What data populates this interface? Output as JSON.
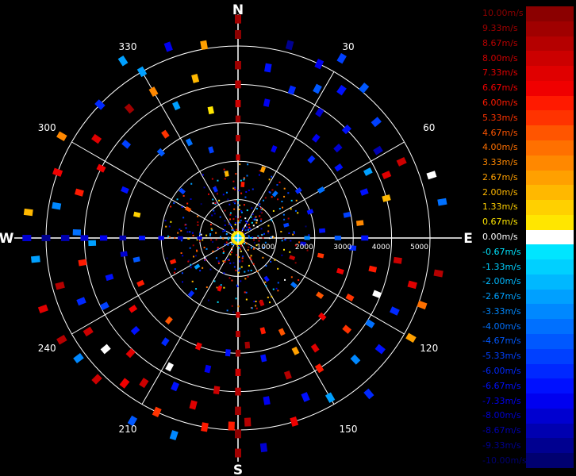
{
  "chart_data": {
    "type": "polar-scatter",
    "title": "",
    "compass": [
      "N",
      "E",
      "S",
      "W"
    ],
    "angle_labels": [
      "30",
      "60",
      "120",
      "150",
      "210",
      "240",
      "300",
      "330"
    ],
    "range_ticks": [
      "1000",
      "2000",
      "3000",
      "4000",
      "5000"
    ],
    "rmax": 5000,
    "grid": true,
    "colorbar": {
      "position": "right",
      "labels": [
        "10.00m/s",
        "9.33m/s",
        "8.67m/s",
        "8.00m/s",
        "7.33m/s",
        "6.67m/s",
        "6.00m/s",
        "5.33m/s",
        "4.67m/s",
        "4.00m/s",
        "3.33m/s",
        "2.67m/s",
        "2.00m/s",
        "1.33m/s",
        "0.67m/s",
        "0.00m/s",
        "-0.67m/s",
        "-1.33m/s",
        "-2.00m/s",
        "-2.67m/s",
        "-3.33m/s",
        "-4.00m/s",
        "-4.67m/s",
        "-5.33m/s",
        "-6.00m/s",
        "-6.67m/s",
        "-7.33m/s",
        "-8.00m/s",
        "-8.67m/s",
        "-9.33m/s",
        "-10.00m/s"
      ],
      "colors": [
        "#8b0000",
        "#a00000",
        "#b50000",
        "#cc0000",
        "#e00000",
        "#f00000",
        "#ff1a00",
        "#ff3300",
        "#ff5500",
        "#ff7000",
        "#ff8800",
        "#ffa000",
        "#ffb800",
        "#ffd000",
        "#ffe600",
        "#ffffff",
        "#00e5ff",
        "#00d0ff",
        "#00b8ff",
        "#00a0ff",
        "#0088ff",
        "#0070ff",
        "#0058ff",
        "#0040ff",
        "#0028ff",
        "#0010ff",
        "#0000f0",
        "#0000d0",
        "#0000b0",
        "#000090",
        "#000070"
      ]
    },
    "points": [
      {
        "az": 0,
        "r": 2100,
        "v": 8.0
      },
      {
        "az": 0,
        "r": 2600,
        "v": 8.67
      },
      {
        "az": 0,
        "r": 3100,
        "v": 9.33
      },
      {
        "az": 0,
        "r": 3500,
        "v": 8.0
      },
      {
        "az": 0,
        "r": 4000,
        "v": 8.67
      },
      {
        "az": 0,
        "r": 4500,
        "v": 9.33
      },
      {
        "az": 0,
        "r": 5300,
        "v": 10.0
      },
      {
        "az": 0,
        "r": 5700,
        "v": 9.33
      },
      {
        "az": 180,
        "r": 2000,
        "v": 8.0
      },
      {
        "az": 180,
        "r": 2500,
        "v": 8.67
      },
      {
        "az": 180,
        "r": 3000,
        "v": 9.33
      },
      {
        "az": 180,
        "r": 3500,
        "v": 8.0
      },
      {
        "az": 180,
        "r": 4000,
        "v": 8.67
      },
      {
        "az": 180,
        "r": 4500,
        "v": 9.33
      },
      {
        "az": 180,
        "r": 5100,
        "v": 10.0
      },
      {
        "az": 180,
        "r": 5600,
        "v": 9.33
      },
      {
        "az": 182,
        "r": 4900,
        "v": 6.0
      },
      {
        "az": 270,
        "r": 1000,
        "v": -8.0
      },
      {
        "az": 270,
        "r": 1500,
        "v": -8.67
      },
      {
        "az": 270,
        "r": 2000,
        "v": -7.33
      },
      {
        "az": 270,
        "r": 2500,
        "v": -6.67
      },
      {
        "az": 270,
        "r": 3000,
        "v": -8.67
      },
      {
        "az": 270,
        "r": 3500,
        "v": -7.33
      },
      {
        "az": 270,
        "r": 4000,
        "v": -8.0
      },
      {
        "az": 270,
        "r": 4500,
        "v": -8.67
      },
      {
        "az": 270,
        "r": 5000,
        "v": -9.33
      },
      {
        "az": 270,
        "r": 5500,
        "v": -8.0
      },
      {
        "az": 272,
        "r": 4200,
        "v": -4.0
      },
      {
        "az": 268,
        "r": 3800,
        "v": -2.67
      },
      {
        "az": 90,
        "r": 1800,
        "v": -3.33
      },
      {
        "az": 90,
        "r": 2600,
        "v": -4.67
      },
      {
        "az": 90,
        "r": 3300,
        "v": -6.67
      },
      {
        "az": 330,
        "r": 5000,
        "v": -2.67
      },
      {
        "az": 330,
        "r": 4400,
        "v": 3.33
      },
      {
        "az": 335,
        "r": 3800,
        "v": -2.67
      },
      {
        "az": 333,
        "r": 2800,
        "v": -4.0
      },
      {
        "az": 325,
        "r": 3300,
        "v": 5.33
      },
      {
        "az": 340,
        "r": 5300,
        "v": -7.33
      },
      {
        "az": 345,
        "r": 4300,
        "v": 2.0
      },
      {
        "az": 350,
        "r": 5100,
        "v": 2.67
      },
      {
        "az": 348,
        "r": 3400,
        "v": 0.67
      },
      {
        "az": 343,
        "r": 2400,
        "v": -5.33
      },
      {
        "az": 320,
        "r": 4400,
        "v": 9.33
      },
      {
        "az": 318,
        "r": 3000,
        "v": -4.67
      },
      {
        "az": 310,
        "r": 3800,
        "v": -5.33
      },
      {
        "az": 305,
        "r": 4500,
        "v": 7.33
      },
      {
        "az": 300,
        "r": 5300,
        "v": 3.33
      },
      {
        "az": 297,
        "r": 4000,
        "v": 6.67
      },
      {
        "az": 293,
        "r": 3200,
        "v": -6.67
      },
      {
        "az": 286,
        "r": 4300,
        "v": 6.0
      },
      {
        "az": 283,
        "r": 2700,
        "v": 1.33
      },
      {
        "az": 280,
        "r": 4800,
        "v": -3.33
      },
      {
        "az": 277,
        "r": 5500,
        "v": 2.0
      },
      {
        "az": 290,
        "r": 5000,
        "v": 6.67
      },
      {
        "az": 314,
        "r": 5000,
        "v": -6.0
      },
      {
        "az": 327,
        "r": 5500,
        "v": -2.67
      },
      {
        "az": 10,
        "r": 4500,
        "v": -6.67
      },
      {
        "az": 12,
        "r": 3600,
        "v": -7.33
      },
      {
        "az": 15,
        "r": 5200,
        "v": -9.33
      },
      {
        "az": 20,
        "r": 4100,
        "v": -6.0
      },
      {
        "az": 25,
        "r": 5000,
        "v": -7.33
      },
      {
        "az": 28,
        "r": 4400,
        "v": -4.67
      },
      {
        "az": 30,
        "r": 5400,
        "v": -5.33
      },
      {
        "az": 33,
        "r": 3900,
        "v": -8.0
      },
      {
        "az": 35,
        "r": 4700,
        "v": -6.67
      },
      {
        "az": 38,
        "r": 3300,
        "v": -7.33
      },
      {
        "az": 40,
        "r": 5100,
        "v": -4.67
      },
      {
        "az": 43,
        "r": 2800,
        "v": -6.0
      },
      {
        "az": 45,
        "r": 4000,
        "v": -6.67
      },
      {
        "az": 48,
        "r": 3500,
        "v": -8.0
      },
      {
        "az": 50,
        "r": 4700,
        "v": -5.33
      },
      {
        "az": 55,
        "r": 3200,
        "v": -6.67
      },
      {
        "az": 58,
        "r": 4300,
        "v": -8.67
      },
      {
        "az": 60,
        "r": 2500,
        "v": -4.0
      },
      {
        "az": 63,
        "r": 3800,
        "v": -2.67
      },
      {
        "az": 65,
        "r": 4700,
        "v": 8.0
      },
      {
        "az": 67,
        "r": 4200,
        "v": 7.33
      },
      {
        "az": 70,
        "r": 3500,
        "v": -6.67
      },
      {
        "az": 72,
        "r": 5300,
        "v": 0.0
      },
      {
        "az": 75,
        "r": 4000,
        "v": 2.0
      },
      {
        "az": 78,
        "r": 2900,
        "v": -5.33
      },
      {
        "az": 80,
        "r": 5400,
        "v": -4.0
      },
      {
        "az": 83,
        "r": 3200,
        "v": 3.33
      },
      {
        "az": 85,
        "r": 2200,
        "v": -6.67
      },
      {
        "az": 22,
        "r": 2500,
        "v": -7.33
      },
      {
        "az": 52,
        "r": 2000,
        "v": -6.0
      },
      {
        "az": 95,
        "r": 3000,
        "v": -6.0
      },
      {
        "az": 98,
        "r": 4200,
        "v": 8.0
      },
      {
        "az": 100,
        "r": 5300,
        "v": 8.67
      },
      {
        "az": 103,
        "r": 3600,
        "v": 6.0
      },
      {
        "az": 105,
        "r": 4700,
        "v": 7.33
      },
      {
        "az": 108,
        "r": 2800,
        "v": 6.67
      },
      {
        "az": 110,
        "r": 5100,
        "v": 4.0
      },
      {
        "az": 112,
        "r": 3900,
        "v": 0.0
      },
      {
        "az": 115,
        "r": 4500,
        "v": -6.0
      },
      {
        "az": 118,
        "r": 3300,
        "v": 5.33
      },
      {
        "az": 120,
        "r": 5200,
        "v": 2.67
      },
      {
        "az": 123,
        "r": 4100,
        "v": -4.0
      },
      {
        "az": 125,
        "r": 2600,
        "v": 4.67
      },
      {
        "az": 128,
        "r": 4700,
        "v": -6.67
      },
      {
        "az": 130,
        "r": 3700,
        "v": 5.33
      },
      {
        "az": 133,
        "r": 3000,
        "v": 6.67
      },
      {
        "az": 136,
        "r": 4400,
        "v": -3.33
      },
      {
        "az": 140,
        "r": 5300,
        "v": -6.0
      },
      {
        "az": 145,
        "r": 3500,
        "v": 7.33
      },
      {
        "az": 148,
        "r": 4000,
        "v": 6.0
      },
      {
        "az": 150,
        "r": 4800,
        "v": -2.67
      },
      {
        "az": 153,
        "r": 3300,
        "v": 2.67
      },
      {
        "az": 155,
        "r": 2700,
        "v": 4.67
      },
      {
        "az": 157,
        "r": 4500,
        "v": -6.67
      },
      {
        "az": 160,
        "r": 3800,
        "v": 8.67
      },
      {
        "az": 163,
        "r": 5000,
        "v": 6.67
      },
      {
        "az": 165,
        "r": 2500,
        "v": 6.0
      },
      {
        "az": 168,
        "r": 3200,
        "v": -6.67
      },
      {
        "az": 170,
        "r": 4300,
        "v": -7.33
      },
      {
        "az": 173,
        "r": 5500,
        "v": -8.0
      },
      {
        "az": 175,
        "r": 2800,
        "v": 9.33
      },
      {
        "az": 177,
        "r": 4800,
        "v": 8.67
      },
      {
        "az": 102,
        "r": 2200,
        "v": 5.33
      },
      {
        "az": 185,
        "r": 3000,
        "v": -6.67
      },
      {
        "az": 188,
        "r": 4000,
        "v": 8.0
      },
      {
        "az": 190,
        "r": 5000,
        "v": 6.0
      },
      {
        "az": 193,
        "r": 3500,
        "v": -7.33
      },
      {
        "az": 195,
        "r": 4500,
        "v": 7.33
      },
      {
        "az": 198,
        "r": 5400,
        "v": -3.33
      },
      {
        "az": 200,
        "r": 3000,
        "v": 6.67
      },
      {
        "az": 203,
        "r": 4200,
        "v": -6.67
      },
      {
        "az": 205,
        "r": 5000,
        "v": 5.33
      },
      {
        "az": 208,
        "r": 3800,
        "v": 0.0
      },
      {
        "az": 210,
        "r": 5500,
        "v": -4.67
      },
      {
        "az": 213,
        "r": 4500,
        "v": 8.0
      },
      {
        "az": 215,
        "r": 3300,
        "v": -6.0
      },
      {
        "az": 218,
        "r": 4800,
        "v": 6.67
      },
      {
        "az": 220,
        "r": 2800,
        "v": 4.67
      },
      {
        "az": 223,
        "r": 4100,
        "v": 7.33
      },
      {
        "az": 225,
        "r": 5200,
        "v": 8.0
      },
      {
        "az": 228,
        "r": 3600,
        "v": -6.67
      },
      {
        "az": 230,
        "r": 4500,
        "v": 0.0
      },
      {
        "az": 233,
        "r": 5200,
        "v": -3.33
      },
      {
        "az": 236,
        "r": 3300,
        "v": 6.67
      },
      {
        "az": 238,
        "r": 4600,
        "v": 8.0
      },
      {
        "az": 240,
        "r": 5300,
        "v": 8.67
      },
      {
        "az": 243,
        "r": 3900,
        "v": -5.33
      },
      {
        "az": 245,
        "r": 2800,
        "v": 6.0
      },
      {
        "az": 248,
        "r": 4400,
        "v": -6.0
      },
      {
        "az": 250,
        "r": 5400,
        "v": 7.33
      },
      {
        "az": 253,
        "r": 3500,
        "v": -6.67
      },
      {
        "az": 255,
        "r": 4800,
        "v": 8.67
      },
      {
        "az": 258,
        "r": 2700,
        "v": -4.67
      },
      {
        "az": 261,
        "r": 4100,
        "v": 6.0
      },
      {
        "az": 264,
        "r": 5300,
        "v": -2.67
      },
      {
        "az": 262,
        "r": 3000,
        "v": -8.0
      },
      {
        "az": 5,
        "r": 1400,
        "v": 6.0
      },
      {
        "az": 40,
        "r": 1500,
        "v": -4.0
      },
      {
        "az": 75,
        "r": 1300,
        "v": -5.33
      },
      {
        "az": 110,
        "r": 1500,
        "v": 8.0
      },
      {
        "az": 145,
        "r": 1300,
        "v": -6.67
      },
      {
        "az": 200,
        "r": 1400,
        "v": 6.67
      },
      {
        "az": 235,
        "r": 1300,
        "v": -2.67
      },
      {
        "az": 300,
        "r": 1500,
        "v": 4.67
      },
      {
        "az": 335,
        "r": 1400,
        "v": -6.0
      },
      {
        "az": 20,
        "r": 1900,
        "v": 2.67
      },
      {
        "az": 70,
        "r": 2000,
        "v": -6.67
      },
      {
        "az": 130,
        "r": 1900,
        "v": -4.0
      },
      {
        "az": 160,
        "r": 1800,
        "v": 8.0
      },
      {
        "az": 220,
        "r": 1900,
        "v": -6.0
      },
      {
        "az": 250,
        "r": 1800,
        "v": 6.0
      },
      {
        "az": 310,
        "r": 1900,
        "v": -5.33
      },
      {
        "az": 350,
        "r": 1700,
        "v": 2.0
      },
      {
        "az": 95,
        "r": 1700,
        "v": -8.0
      }
    ]
  }
}
